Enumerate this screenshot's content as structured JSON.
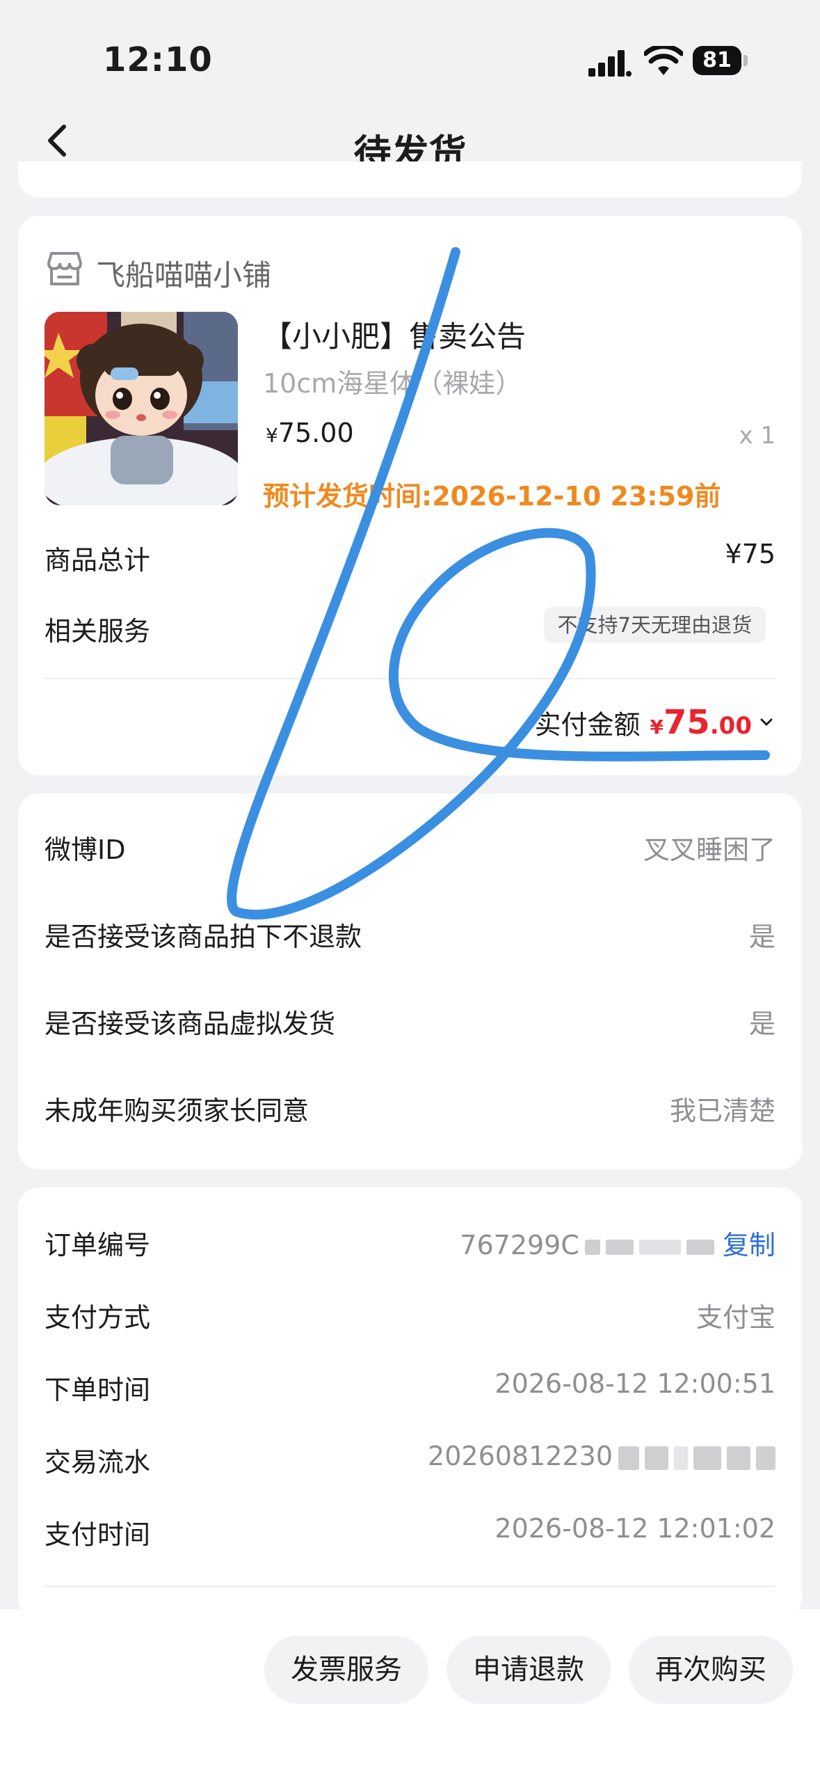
{
  "status_bar": {
    "time": "12:10",
    "battery": "81"
  },
  "nav": {
    "title": "待发货"
  },
  "shop": {
    "name": "飞船喵喵小铺"
  },
  "product": {
    "title": "【小小肥】售卖公告",
    "spec": "10cm海星体（裸娃）",
    "price_symbol": "¥",
    "price": "75.00",
    "quantity": "x 1",
    "ship_time": "预计发货时间:2026-12-10 23:59前"
  },
  "summary": {
    "total_label": "商品总计",
    "total_value": "¥75",
    "service_label": "相关服务",
    "service_badge": "不支持7天无理由退货",
    "paid_label": "实付金额",
    "paid_symbol": "¥",
    "paid_int": "75",
    "paid_dec": ".00"
  },
  "info_rows": [
    {
      "label": "微博ID",
      "value": "叉叉睡困了"
    },
    {
      "label": "是否接受该商品拍下不退款",
      "value": "是"
    },
    {
      "label": "是否接受该商品虚拟发货",
      "value": "是"
    },
    {
      "label": "未成年购买须家长同意",
      "value": "我已清楚"
    }
  ],
  "order": {
    "number_label": "订单编号",
    "number_value": "767299C",
    "copy_label": "复制",
    "pay_method_label": "支付方式",
    "pay_method_value": "支付宝",
    "order_time_label": "下单时间",
    "order_time_value": "2026-08-12 12:00:51",
    "txn_label": "交易流水",
    "txn_value": "20260812230",
    "pay_time_label": "支付时间",
    "pay_time_value": "2026-08-12 12:01:02"
  },
  "actions": {
    "invoice": "发票服务",
    "refund": "申请退款",
    "rebuy": "再次购买"
  },
  "colors": {
    "accent_red": "#e8242f",
    "orange": "#ef8a1f",
    "link_blue": "#2f6fd6",
    "scribble_blue": "#3b8fe0"
  }
}
